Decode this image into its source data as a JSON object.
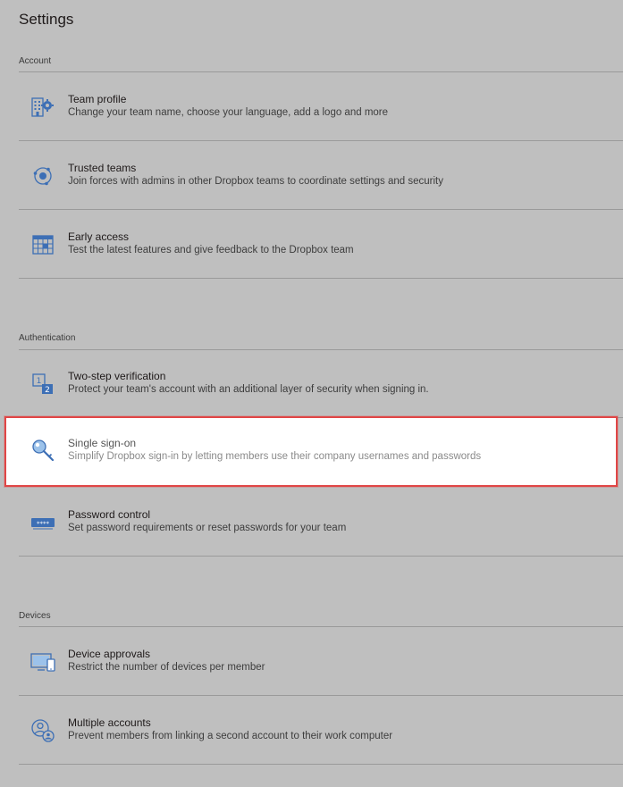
{
  "page": {
    "title": "Settings"
  },
  "colors": {
    "accent": "#3d6fb5",
    "highlight_border": "#e04646",
    "background": "#bfbfbf"
  },
  "sections": [
    {
      "header": "Account",
      "items": [
        {
          "icon": "team-profile-icon",
          "title": "Team profile",
          "description": "Change your team name, choose your language, add a logo and more"
        },
        {
          "icon": "trusted-teams-icon",
          "title": "Trusted teams",
          "description": "Join forces with admins in other Dropbox teams to coordinate settings and security"
        },
        {
          "icon": "calendar-icon",
          "title": "Early access",
          "description": "Test the latest features and give feedback to the Dropbox team"
        }
      ]
    },
    {
      "header": "Authentication",
      "items": [
        {
          "icon": "two-step-icon",
          "title": "Two-step verification",
          "description": "Protect your team's account with an additional layer of security when signing in."
        },
        {
          "icon": "key-icon",
          "title": "Single sign-on",
          "description": "Simplify Dropbox sign-in by letting members use their company usernames and passwords"
        },
        {
          "icon": "password-icon",
          "title": "Password control",
          "description": "Set password requirements or reset passwords for your team"
        }
      ]
    },
    {
      "header": "Devices",
      "items": [
        {
          "icon": "device-icon",
          "title": "Device approvals",
          "description": "Restrict the number of devices per member"
        },
        {
          "icon": "multiple-accounts-icon",
          "title": "Multiple accounts",
          "description": "Prevent members from linking a second account to their work computer"
        }
      ]
    }
  ]
}
